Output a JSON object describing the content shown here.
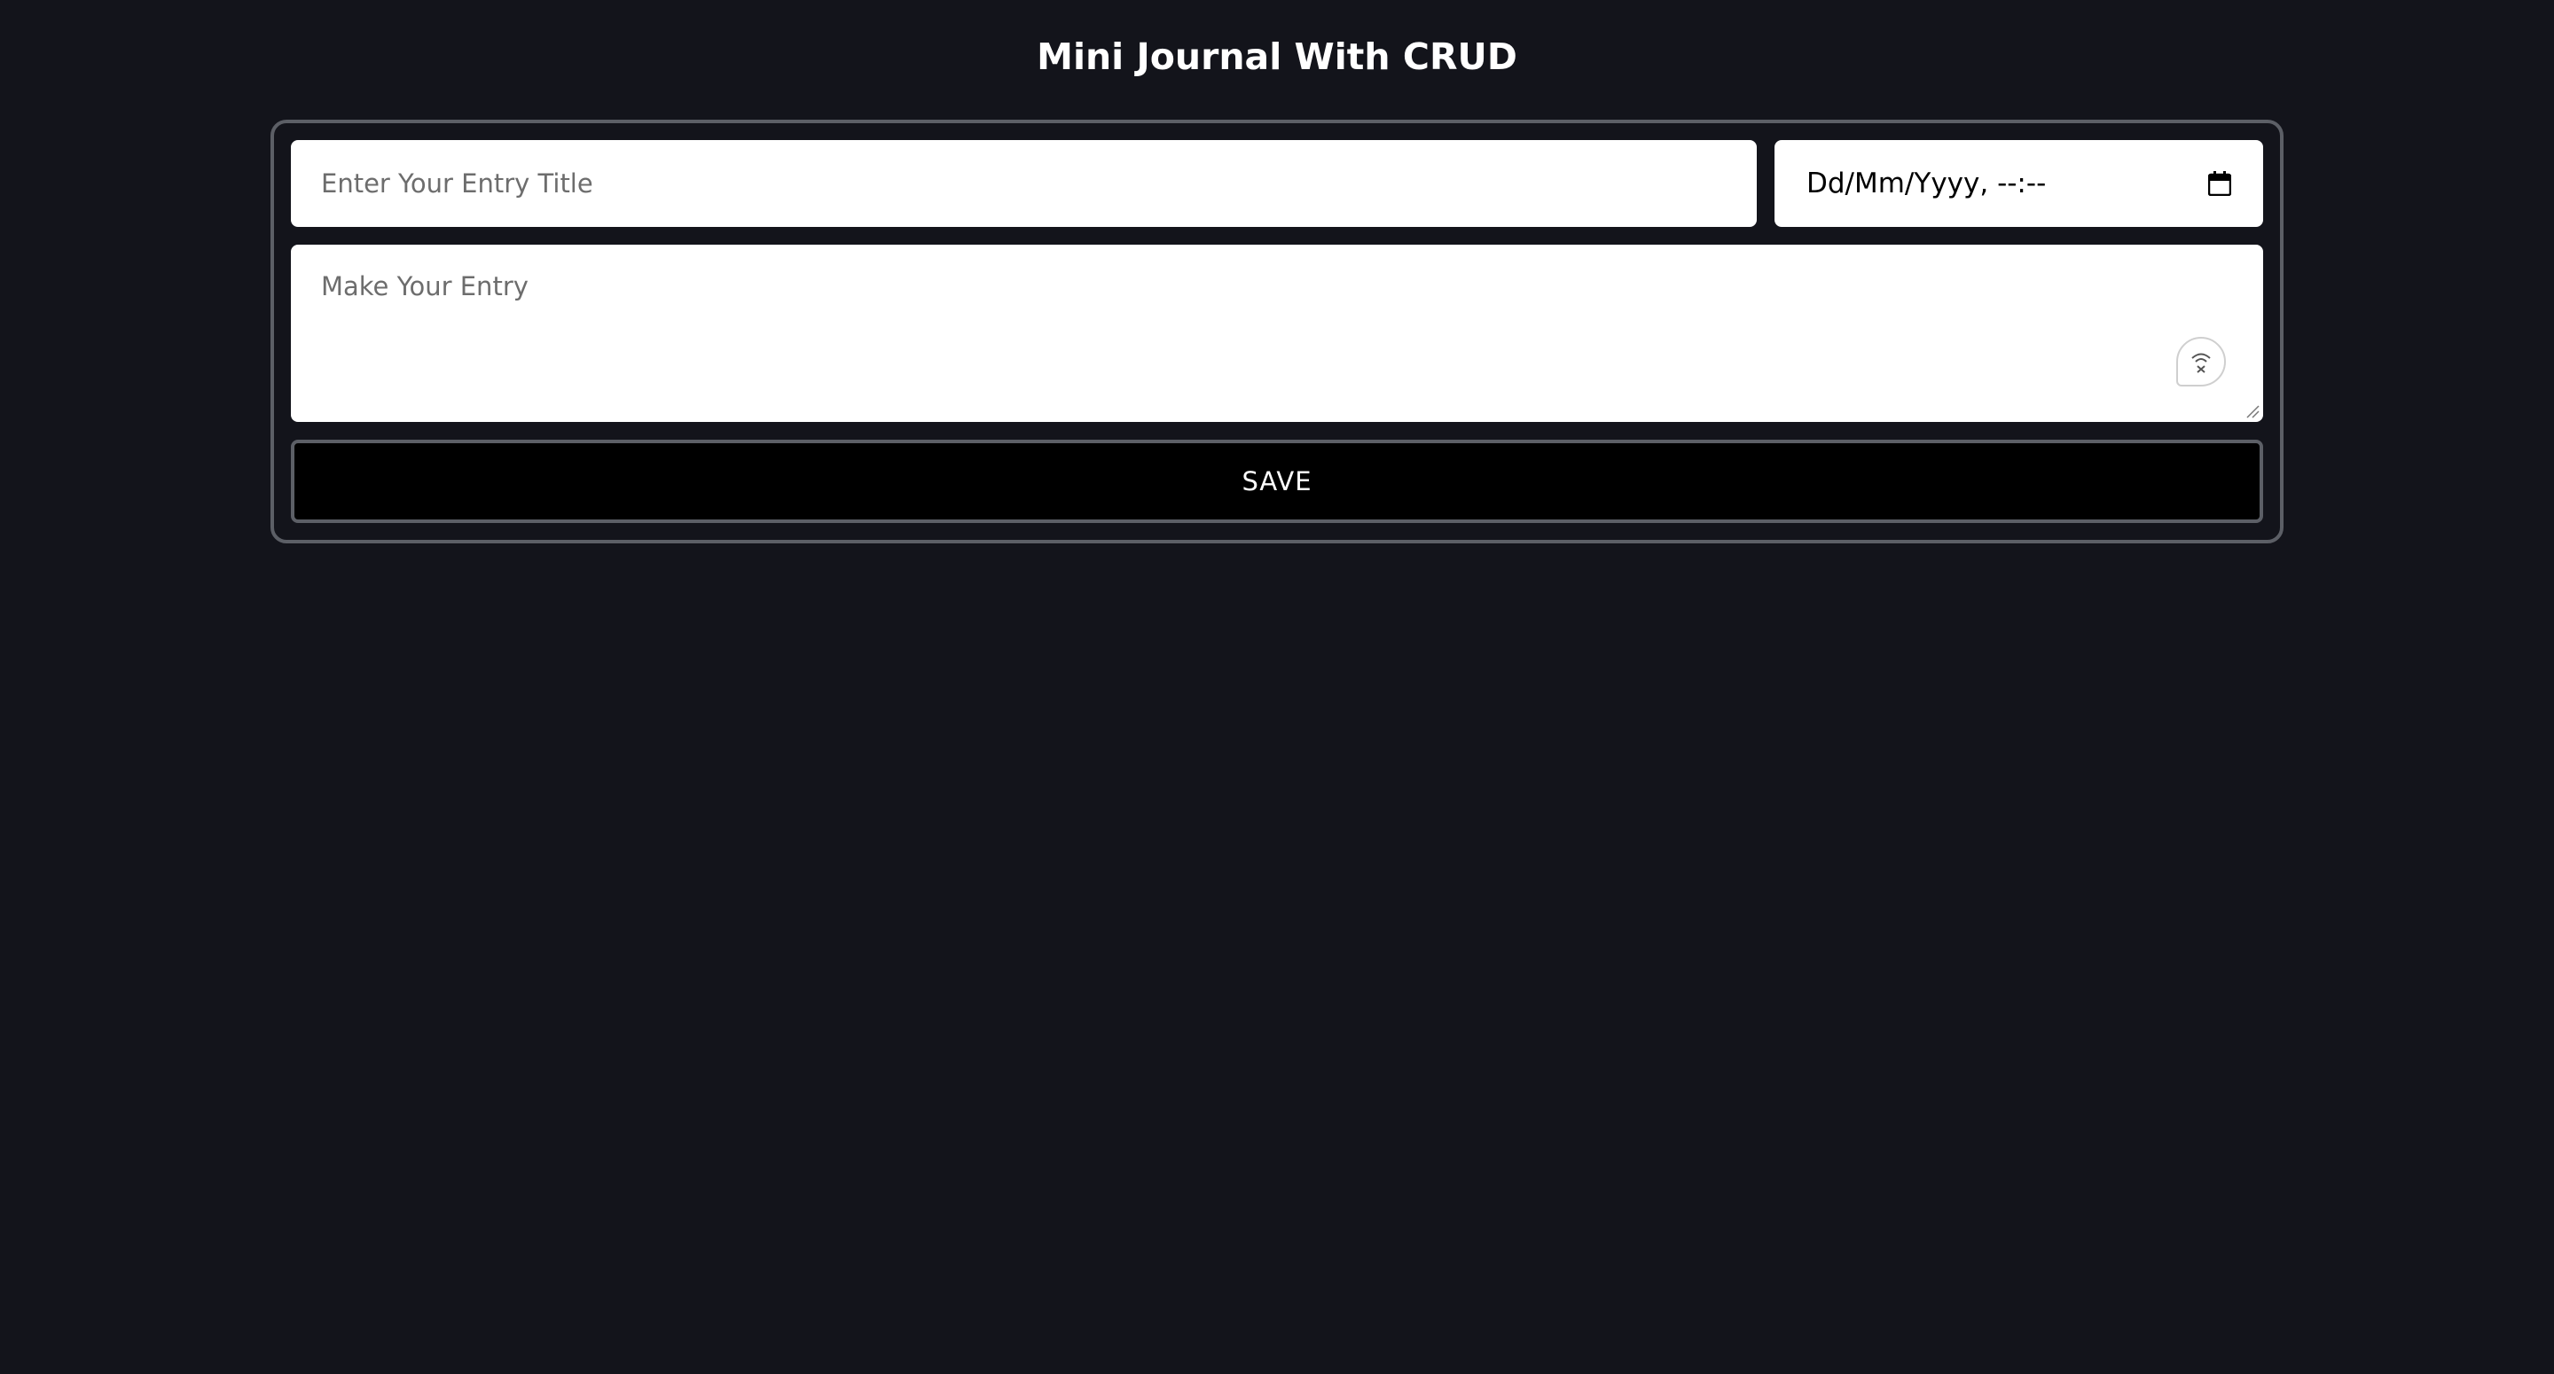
{
  "header": {
    "title": "Mini Journal With CRUD"
  },
  "form": {
    "title_placeholder": "Enter Your Entry Title",
    "title_value": "",
    "datetime_display": "Dd/Mm/Yyyy, --:--",
    "entry_placeholder": "Make Your Entry",
    "entry_value": "",
    "save_label": "SAVE"
  },
  "icons": {
    "calendar": "calendar-icon",
    "voice": "voice-input-icon",
    "resize": "resize-grip-icon"
  },
  "colors": {
    "background": "#13141b",
    "card_border": "#5c5f66",
    "input_bg": "#ffffff",
    "button_bg": "#000000",
    "text_light": "#ffffff"
  }
}
